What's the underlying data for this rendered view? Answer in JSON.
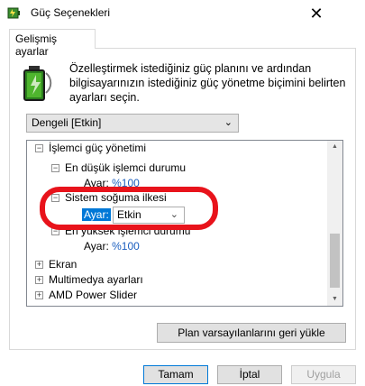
{
  "window": {
    "title": "Güç Seçenekleri",
    "close_glyph": "✕",
    "icon": "power-options-icon"
  },
  "tab": {
    "label": "Gelişmiş ayarlar"
  },
  "description": "Özelleştirmek istediğiniz güç planını ve ardından bilgisayarınızın istediğiniz güç yönetme biçimini belirten ayarları seçin.",
  "plan": {
    "selected": "Dengeli [Etkin]",
    "chevron": "⌄"
  },
  "tree": {
    "processor": {
      "label": "İşlemci güç yönetimi",
      "toggle": "−"
    },
    "min_state": {
      "label": "En düşük işlemci durumu",
      "toggle": "−",
      "setting_label": "Ayar:",
      "value": "%100"
    },
    "cooling": {
      "label": "Sistem soğuma ilkesi",
      "toggle": "−",
      "setting_label": "Ayar:",
      "value": "Etkin",
      "chevron": "⌄"
    },
    "max_state": {
      "label": "En yüksek işlemci durumu",
      "toggle": "−",
      "setting_label": "Ayar:",
      "value": "%100"
    },
    "display": {
      "label": "Ekran",
      "toggle": "+"
    },
    "multimedia": {
      "label": "Multimedya ayarları",
      "toggle": "+"
    },
    "amd": {
      "label": "AMD Power Slider",
      "toggle": "+"
    }
  },
  "scrollbar": {
    "up": "▲",
    "down": "▼"
  },
  "buttons": {
    "restore": "Plan varsayılanlarını geri yükle",
    "ok": "Tamam",
    "cancel": "İptal",
    "apply": "Uygula"
  },
  "colors": {
    "accent": "#0078d7",
    "value_blue": "#1c5fbf",
    "annotation_red": "#e8131b"
  }
}
